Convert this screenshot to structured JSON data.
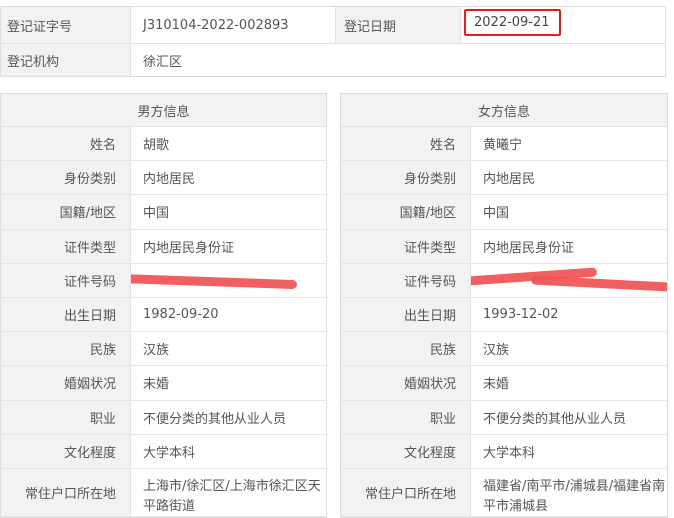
{
  "header": {
    "reg_no_label": "登记证字号",
    "reg_no_value": "J310104-2022-002893",
    "reg_date_label": "登记日期",
    "reg_date_value": "2022-09-21",
    "reg_org_label": "登记机构",
    "reg_org_value": "徐汇区"
  },
  "male": {
    "title": "男方信息",
    "rows": [
      {
        "label": "姓名",
        "value": "胡歌"
      },
      {
        "label": "身份类别",
        "value": "内地居民"
      },
      {
        "label": "国籍/地区",
        "value": "中国"
      },
      {
        "label": "证件类型",
        "value": "内地居民身份证"
      },
      {
        "label": "证件号码",
        "value": ""
      },
      {
        "label": "出生日期",
        "value": "1982-09-20"
      },
      {
        "label": "民族",
        "value": "汉族"
      },
      {
        "label": "婚姻状况",
        "value": "未婚"
      },
      {
        "label": "职业",
        "value": "不便分类的其他从业人员"
      },
      {
        "label": "文化程度",
        "value": "大学本科"
      },
      {
        "label": "常住户口所在地",
        "value": "上海市/徐汇区/上海市徐汇区天平路街道"
      }
    ]
  },
  "female": {
    "title": "女方信息",
    "rows": [
      {
        "label": "姓名",
        "value": "黄曦宁"
      },
      {
        "label": "身份类别",
        "value": "内地居民"
      },
      {
        "label": "国籍/地区",
        "value": "中国"
      },
      {
        "label": "证件类型",
        "value": "内地居民身份证"
      },
      {
        "label": "证件号码",
        "value": ""
      },
      {
        "label": "出生日期",
        "value": "1993-12-02"
      },
      {
        "label": "民族",
        "value": "汉族"
      },
      {
        "label": "婚姻状况",
        "value": "未婚"
      },
      {
        "label": "职业",
        "value": "不便分类的其他从业人员"
      },
      {
        "label": "文化程度",
        "value": "大学本科"
      },
      {
        "label": "常住户口所在地",
        "value": "福建省/南平市/浦城县/福建省南平市浦城县"
      }
    ]
  },
  "colors": {
    "highlight_box": "#e02020",
    "redaction": "#ef5353",
    "label_bg": "#f2f2f2"
  }
}
